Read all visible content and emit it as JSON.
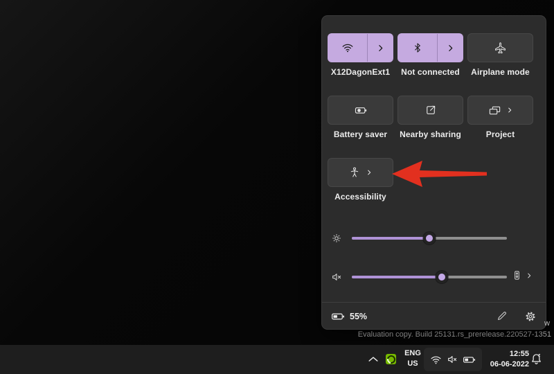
{
  "colors": {
    "accent": "#c5aae0",
    "slider_fill": "#af92d6",
    "thumb": "#c3a8e6",
    "panel_bg": "#2c2c2c",
    "tile_bg": "#3a3a3a",
    "taskbar_bg": "#1e1e1e",
    "arrow_red": "#e2301f"
  },
  "quick_settings": {
    "tiles": [
      {
        "id": "wifi",
        "icon": "wifi-icon",
        "label": "X12DagonExt1",
        "active": true,
        "split": true
      },
      {
        "id": "bluetooth",
        "icon": "bluetooth-icon",
        "label": "Not connected",
        "active": true,
        "split": true
      },
      {
        "id": "airplane-mode",
        "icon": "airplane-icon",
        "label": "Airplane mode",
        "active": false
      },
      {
        "id": "battery-saver",
        "icon": "battery-saver-icon",
        "label": "Battery saver",
        "active": false
      },
      {
        "id": "nearby-sharing",
        "icon": "share-icon",
        "label": "Nearby sharing",
        "active": false
      },
      {
        "id": "project",
        "icon": "project-icon",
        "label": "Project",
        "active": false,
        "chevron": true
      },
      {
        "id": "accessibility",
        "icon": "accessibility-icon",
        "label": "Accessibility",
        "active": false,
        "chevron": true
      }
    ],
    "sliders": {
      "brightness": {
        "percent": 50,
        "fill_style": "width:50%",
        "thumb_style": "left:50%",
        "icon": "brightness-sun-icon"
      },
      "volume": {
        "percent": 58,
        "muted": true,
        "fill_style": "width:58%",
        "thumb_style": "left:58%",
        "icon": "volume-muted-icon"
      }
    },
    "footer": {
      "battery_percent": "55%",
      "icons": [
        "battery-icon",
        "edit-pencil-icon",
        "settings-gear-icon"
      ]
    }
  },
  "watermark": {
    "line1_fragment": "w",
    "line2": "Evaluation copy. Build 25131.rs_prerelease.220527-1351"
  },
  "taskbar": {
    "language_line1": "ENG",
    "language_line2": "US",
    "time": "12:55",
    "date": "06-06-2022",
    "tray_icons": [
      "chevron-up-icon",
      "nvidia-icon",
      "wifi-icon",
      "volume-muted-icon",
      "battery-icon",
      "bell-dnd-icon"
    ]
  }
}
